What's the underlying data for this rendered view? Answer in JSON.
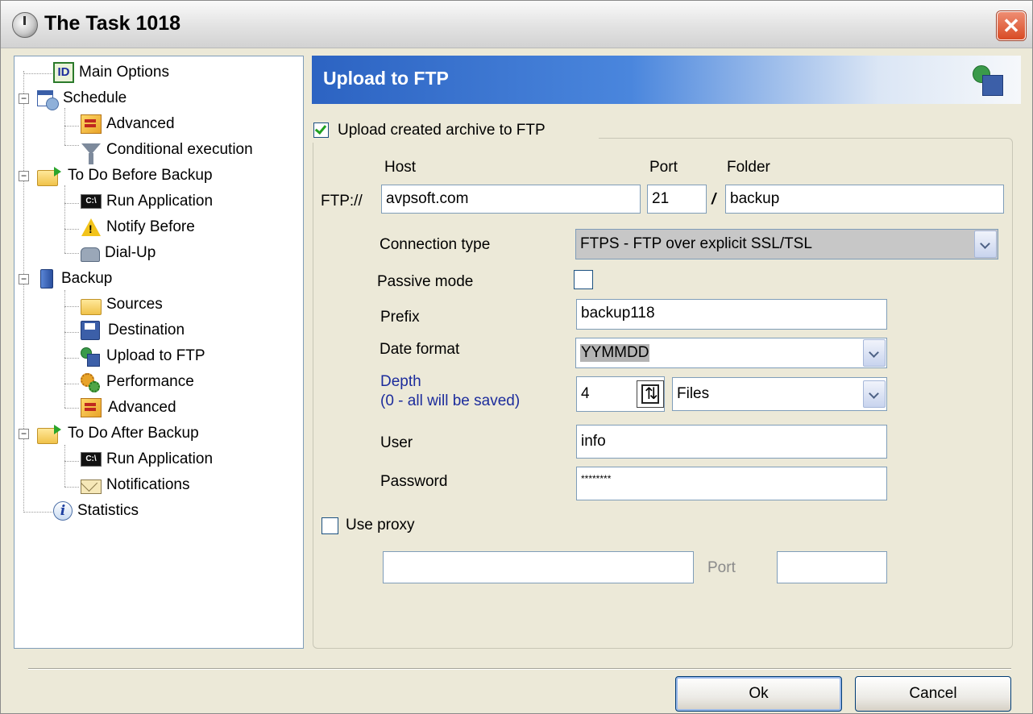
{
  "window": {
    "title": "The Task 1018",
    "close_label": "✕"
  },
  "tree": {
    "items": [
      {
        "label": "Main Options",
        "icon": "id-icon"
      },
      {
        "label": "Schedule",
        "icon": "calendar-clock-icon"
      },
      {
        "label": "Advanced",
        "icon": "advanced-icon"
      },
      {
        "label": "Conditional execution",
        "icon": "funnel-icon"
      },
      {
        "label": "To Do Before Backup",
        "icon": "folder-arrow-icon"
      },
      {
        "label": "Run Application",
        "icon": "command-prompt-icon"
      },
      {
        "label": "Notify Before",
        "icon": "warning-icon"
      },
      {
        "label": "Dial-Up",
        "icon": "phone-icon"
      },
      {
        "label": "Backup",
        "icon": "computer-icon"
      },
      {
        "label": "Sources",
        "icon": "folder-icon"
      },
      {
        "label": "Destination",
        "icon": "floppy-disk-icon"
      },
      {
        "label": "Upload to FTP",
        "icon": "upload-ftp-icon"
      },
      {
        "label": "Performance",
        "icon": "gears-icon"
      },
      {
        "label": "Advanced",
        "icon": "advanced-icon"
      },
      {
        "label": "To Do After Backup",
        "icon": "folder-arrow-icon"
      },
      {
        "label": "Run Application",
        "icon": "command-prompt-icon"
      },
      {
        "label": "Notifications",
        "icon": "envelope-icon"
      },
      {
        "label": "Statistics",
        "icon": "info-icon"
      }
    ],
    "expander_symbol": "−"
  },
  "panel": {
    "title": "Upload to FTP",
    "header_icon": "upload-ftp-icon"
  },
  "form": {
    "upload_checkbox_label": "Upload created archive to FTP",
    "upload_checked": true,
    "host_label": "Host",
    "port_label": "Port",
    "folder_label": "Folder",
    "ftp_prefix": "FTP://",
    "host_value": "avpsoft.com",
    "port_value": "21",
    "slash": "/",
    "folder_value": "backup",
    "connection_type_label": "Connection type",
    "connection_type_value": "FTPS - FTP over explicit SSL/TSL",
    "passive_mode_label": "Passive mode",
    "passive_mode_checked": false,
    "prefix_label": "Prefix",
    "prefix_value": "backup118",
    "date_format_label": "Date format",
    "date_format_value": "YYMMDD",
    "depth_label": "Depth",
    "depth_hint": "(0 - all will be saved)",
    "depth_value": "4",
    "depth_unit_value": "Files",
    "user_label": "User",
    "user_value": "info",
    "password_label": "Password",
    "password_value": "********",
    "use_proxy_label": "Use proxy",
    "use_proxy_checked": false,
    "proxy_host_value": "",
    "proxy_port_label": "Port",
    "proxy_port_value": ""
  },
  "buttons": {
    "ok_label": "Ok",
    "cancel_label": "Cancel"
  },
  "colors": {
    "header_gradient_start": "#2c63c2",
    "depth_label_color": "#1c2c9c",
    "check_color": "#21a121"
  }
}
